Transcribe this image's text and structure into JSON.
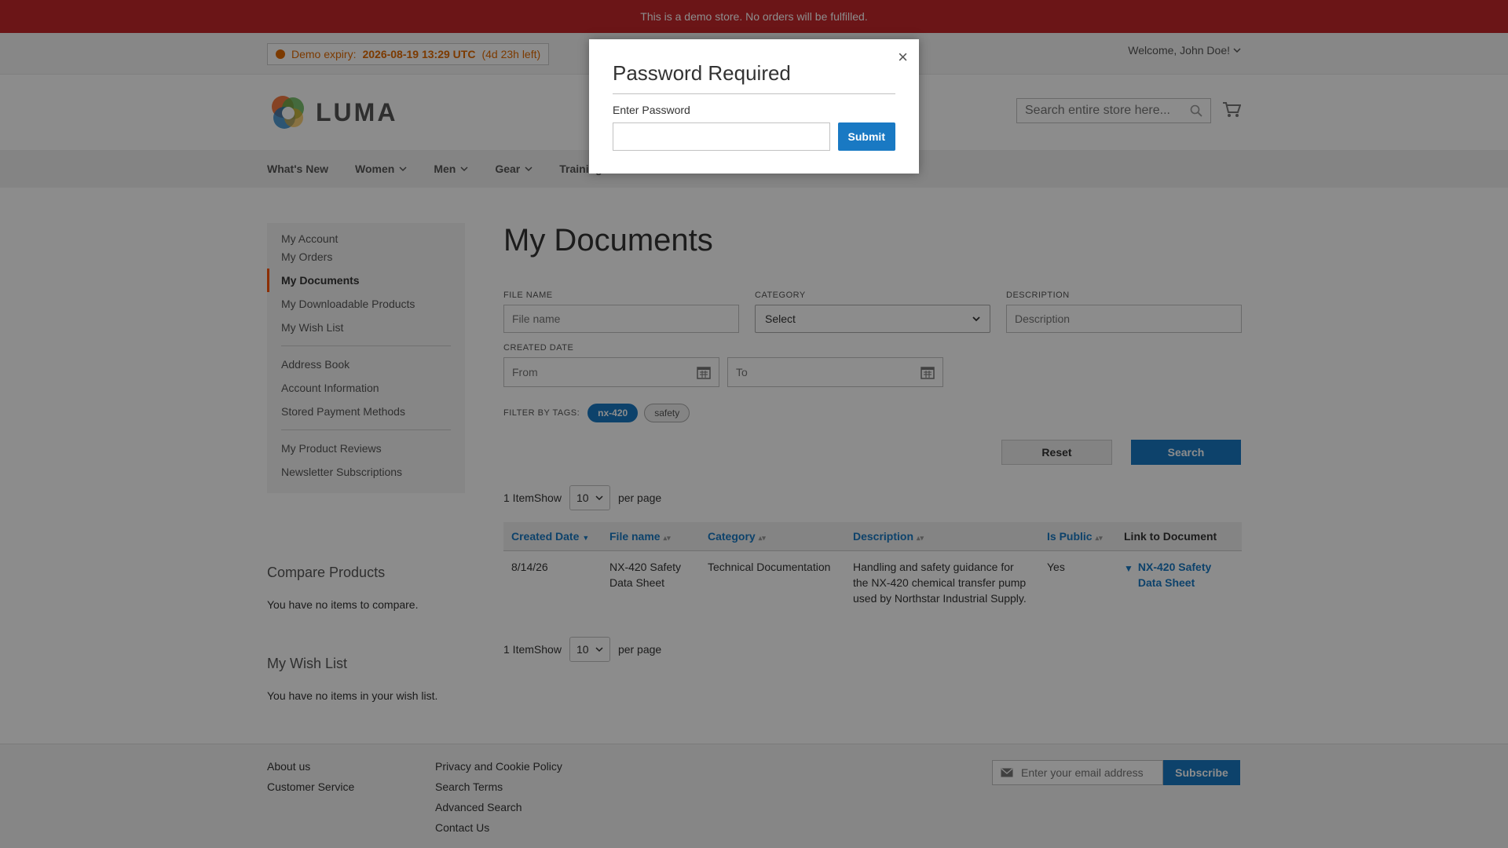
{
  "banner": {
    "text": "This is a demo store. No orders will be fulfilled."
  },
  "header": {
    "expiry_label": "Demo expiry:",
    "expiry_date": "2026-08-19 13:29 UTC",
    "expiry_left": "(4d 23h left)",
    "welcome": "Welcome, John Doe!",
    "logo_text": "LUMA",
    "search_placeholder": "Search entire store here..."
  },
  "nav": {
    "items": [
      "What's New",
      "Women",
      "Men",
      "Gear",
      "Training"
    ]
  },
  "sidebar": {
    "group1": [
      "My Account",
      "My Orders",
      "My Documents",
      "My Downloadable Products",
      "My Wish List"
    ],
    "group2": [
      "Address Book",
      "Account Information",
      "Stored Payment Methods"
    ],
    "group3": [
      "My Product Reviews",
      "Newsletter Subscriptions"
    ],
    "active": "My Documents"
  },
  "compare": {
    "title": "Compare Products",
    "empty": "You have no items to compare."
  },
  "wishlist": {
    "title": "My Wish List",
    "empty": "You have no items in your wish list."
  },
  "main": {
    "title": "My Documents",
    "filters": {
      "file_name_label": "FILE NAME",
      "file_name_placeholder": "File name",
      "category_label": "CATEGORY",
      "category_value": "Select",
      "description_label": "DESCRIPTION",
      "description_placeholder": "Description",
      "created_date_label": "CREATED DATE",
      "from_placeholder": "From",
      "to_placeholder": "To",
      "tags_label": "FILTER BY TAGS:",
      "tags": [
        "nx-420",
        "safety"
      ],
      "reset_label": "Reset",
      "search_label": "Search"
    },
    "toolbar": {
      "count": "1 Item",
      "show": "Show",
      "limit": "10",
      "per_page": "per page"
    },
    "table": {
      "headers": [
        "Created Date",
        "File name",
        "Category",
        "Description",
        "Is Public",
        "Link to Document"
      ],
      "rows": [
        {
          "created": "8/14/26",
          "file_name": "NX-420 Safety Data Sheet",
          "category": "Technical Documentation",
          "description": "Handling and safety guidance for the NX-420 chemical transfer pump used by Northstar Industrial Supply.",
          "is_public": "Yes",
          "link": "NX-420 Safety Data Sheet"
        }
      ]
    }
  },
  "footer": {
    "col1": [
      "About us",
      "Customer Service"
    ],
    "col2": [
      "Privacy and Cookie Policy",
      "Search Terms",
      "Advanced Search",
      "Contact Us"
    ],
    "newsletter_placeholder": "Enter your email address",
    "subscribe_label": "Subscribe"
  },
  "modal": {
    "title": "Password Required",
    "label": "Enter Password",
    "submit": "Submit",
    "close": "×"
  },
  "colors": {
    "accent": "#1979c3",
    "banner": "#c3272b",
    "active_marker": "#ff5501"
  }
}
